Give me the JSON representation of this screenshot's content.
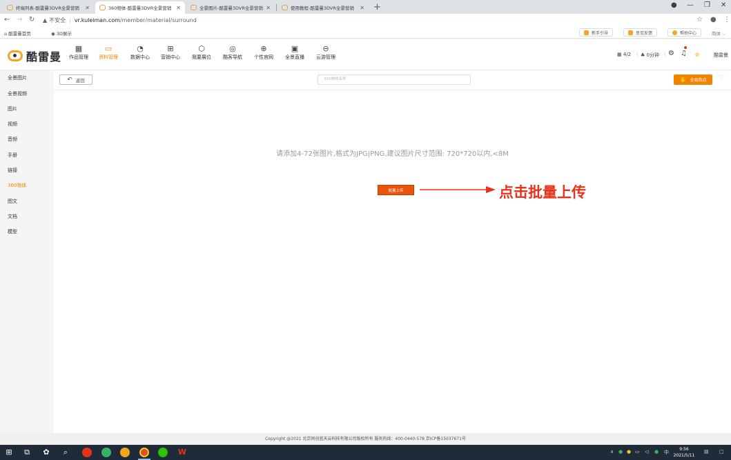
{
  "browser": {
    "tabs": [
      {
        "title": "终端列表-酷雷曼3DVR全景营销"
      },
      {
        "title": "360物体-酷雷曼3DVR全景营销"
      },
      {
        "title": "全景图片-酷雷曼3DVR全景营销"
      },
      {
        "title": "使用教程-酷雷曼3DVR全景营销"
      }
    ],
    "new_tab": "+",
    "security_label": "不安全",
    "url_host": "vr.kuleiman.com",
    "url_path": "/member/material/surround"
  },
  "bookmarks": {
    "items": [
      "酷雷曼首页",
      "3D展示"
    ],
    "right_pills": [
      {
        "label": "新手引导",
        "color": "#f5a623"
      },
      {
        "label": "意见反馈",
        "color": "#f5a623"
      },
      {
        "label": "帮助中心",
        "color": "#f5a623"
      }
    ],
    "language": "简体"
  },
  "header": {
    "logo": "酷雷曼",
    "nav": [
      {
        "label": "作品管理",
        "icon": "grid-icon",
        "glyph": "▦"
      },
      {
        "label": "资料管理",
        "icon": "folder-icon",
        "glyph": "▭"
      },
      {
        "label": "数据中心",
        "icon": "chart-pie-icon",
        "glyph": "◔"
      },
      {
        "label": "营销中心",
        "icon": "gift-icon",
        "glyph": "⊞"
      },
      {
        "label": "我要展位",
        "icon": "cube-icon",
        "glyph": "⬡"
      },
      {
        "label": "酷客导航",
        "icon": "location-icon",
        "glyph": "◎"
      },
      {
        "label": "个性官网",
        "icon": "globe-icon",
        "glyph": "⊕"
      },
      {
        "label": "全景直播",
        "icon": "tv-icon",
        "glyph": "▣"
      },
      {
        "label": "云游管理",
        "icon": "planet-icon",
        "glyph": "⊖"
      }
    ],
    "active_nav": 1,
    "counts": "4/2",
    "minutes": "0分钟",
    "user": "酷雷曼"
  },
  "sidebar": {
    "items": [
      "全景图片",
      "全景视频",
      "图片",
      "视频",
      "音频",
      "手册",
      "链接",
      "360物体",
      "图文",
      "文档",
      "模型"
    ],
    "active": 7
  },
  "main": {
    "back_label": "返回",
    "search_placeholder": "360物体名称",
    "hotspot_label": "全局热点",
    "hint": "请添加4-72张图片,格式为JPG|PNG,建议图片尺寸范围: 720*720以内,<8M",
    "upload_label": "批量上传",
    "annotation": "点击批量上传"
  },
  "footer": {
    "text": "Copyright @2021 北京同创蓝天云科技有限公司版权所有 服务热线：400-0440-578 京ICP备15037671号"
  },
  "taskbar": {
    "time": "9:56",
    "date": "2021/5/11",
    "ime": "中"
  }
}
